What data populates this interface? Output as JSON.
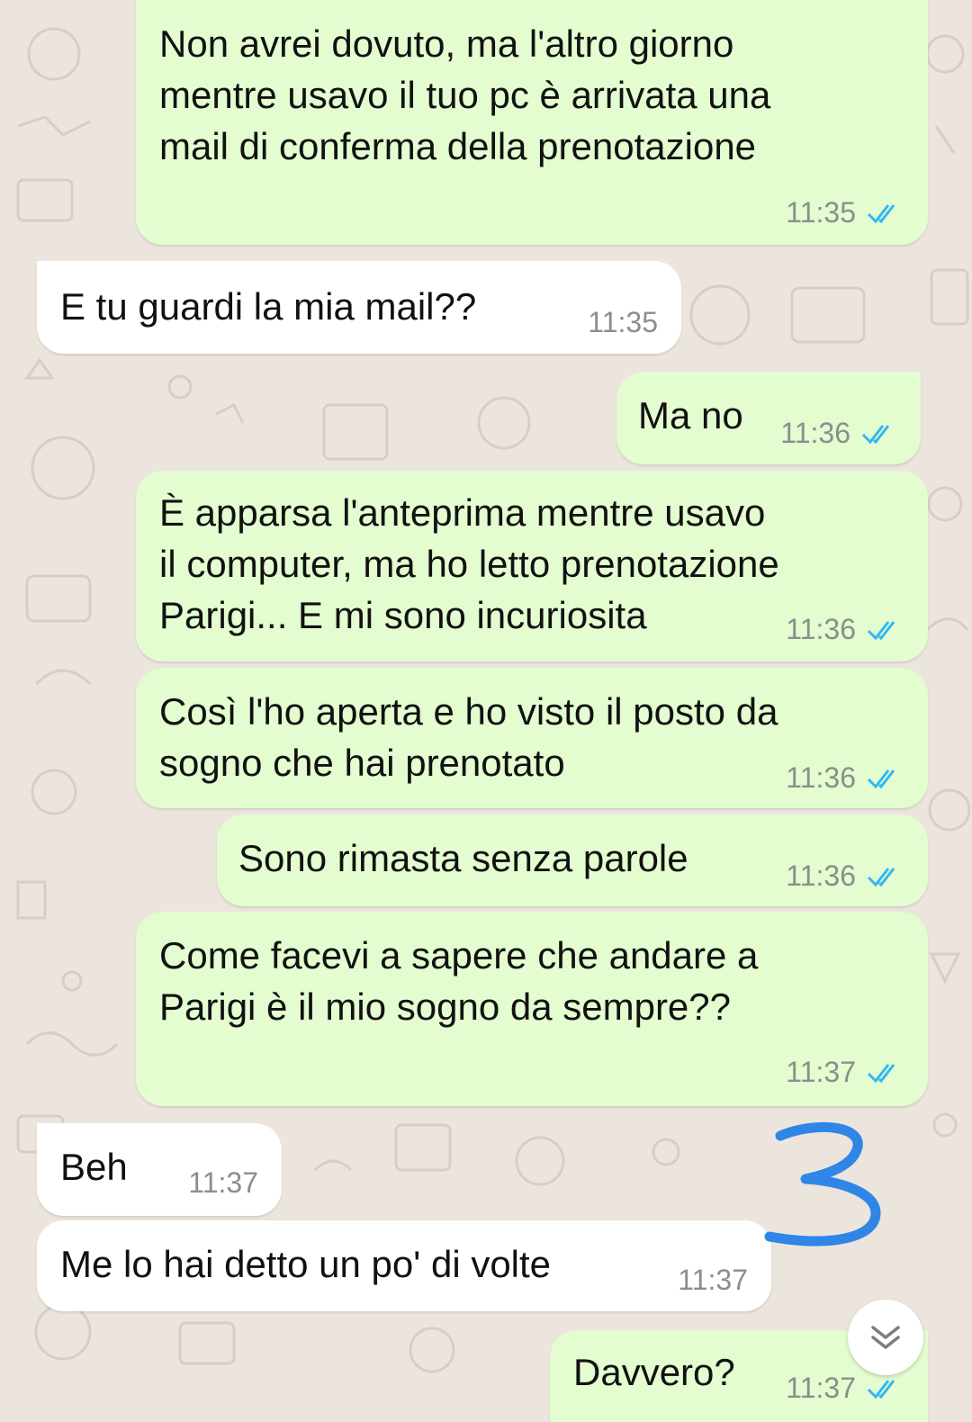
{
  "colors": {
    "outgoing_bubble": "#e3fcd0",
    "incoming_bubble": "#ffffff",
    "read_ticks": "#34b7f1",
    "wallpaper": "#ece5dd",
    "annotation_marker": "#2f86e6"
  },
  "annotation": {
    "label": "3"
  },
  "scroll_button": {
    "icon": "double-chevron-down-icon"
  },
  "messages": [
    {
      "direction": "out",
      "text": "Non avrei dovuto, ma l'altro giorno\nmentre usavo il tuo pc è arrivata una\nmail di conferma della prenotazione",
      "time": "11:35",
      "status": "read"
    },
    {
      "direction": "in",
      "text": "E tu guardi la mia mail??",
      "time": "11:35"
    },
    {
      "direction": "out",
      "text": "Ma no",
      "time": "11:36",
      "status": "read"
    },
    {
      "direction": "out",
      "text": "È apparsa l'anteprima mentre usavo\nil computer, ma ho letto prenotazione\nParigi... E mi sono incuriosita",
      "time": "11:36",
      "status": "read"
    },
    {
      "direction": "out",
      "text": "Così l'ho aperta e ho visto il posto da\nsogno che hai prenotato",
      "time": "11:36",
      "status": "read"
    },
    {
      "direction": "out",
      "text": "Sono rimasta senza parole",
      "time": "11:36",
      "status": "read"
    },
    {
      "direction": "out",
      "text": "Come facevi a sapere che andare a\nParigi è il mio sogno da sempre??",
      "time": "11:37",
      "status": "read"
    },
    {
      "direction": "in",
      "text": "Beh",
      "time": "11:37"
    },
    {
      "direction": "in",
      "text": "Me lo hai detto un po' di volte",
      "time": "11:37"
    },
    {
      "direction": "out",
      "text": "Davvero?",
      "time": "11:37",
      "status": "read"
    }
  ]
}
